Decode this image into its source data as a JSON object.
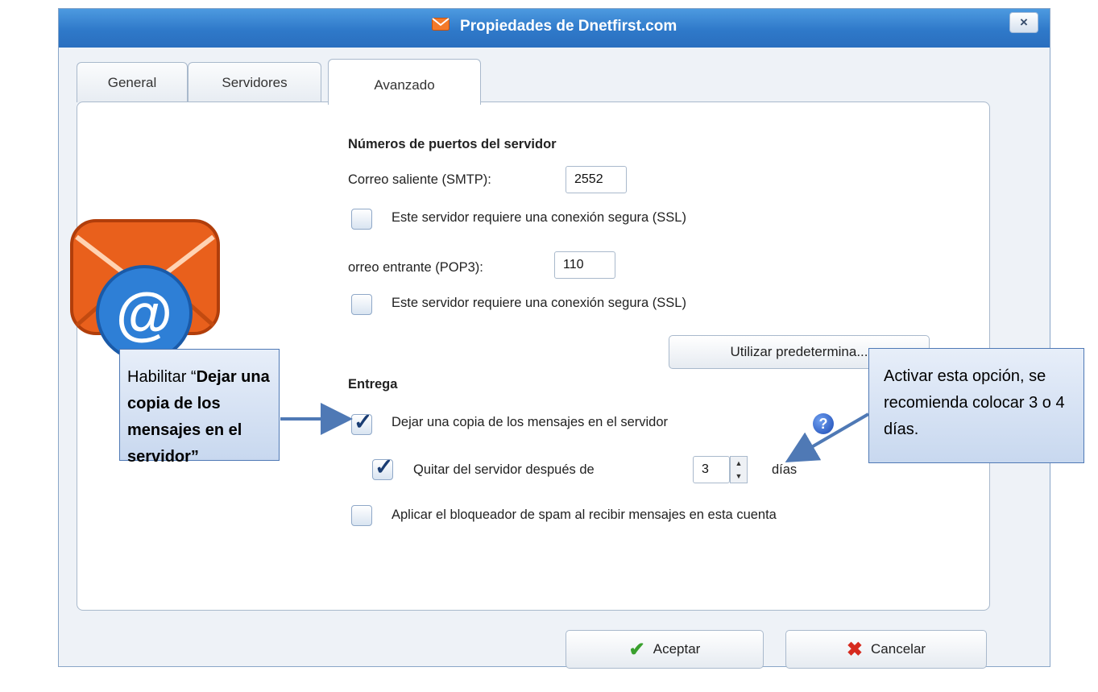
{
  "window": {
    "title": "Propiedades de Dnetfirst.com",
    "close_label": "×"
  },
  "tabs": [
    {
      "label": "General"
    },
    {
      "label": "Servidores"
    },
    {
      "label": "Avanzado"
    }
  ],
  "ports": {
    "heading": "Números de puertos del servidor",
    "smtp_label": "Correo saliente (SMTP):",
    "smtp_value": "2552",
    "smtp_ssl_label": "Este servidor requiere una conexión segura (SSL)",
    "smtp_ssl_checked": false,
    "pop3_label": "orreo entrante (POP3):",
    "pop3_value": "110",
    "pop3_ssl_label": "Este servidor requiere una conexión segura (SSL)",
    "pop3_ssl_checked": false,
    "defaults_button": "Utilizar predetermina..."
  },
  "delivery": {
    "heading": "Entrega",
    "leave_copy_label": "Dejar una copia de los mensajes en el servidor",
    "leave_copy_checked": true,
    "remove_after_label": "Quitar del servidor después de",
    "remove_after_checked": true,
    "days_value": "3",
    "days_label": "días",
    "spam_label": "Aplicar el bloqueador de spam al recibir mensajes en esta cuenta",
    "spam_checked": false,
    "help_glyph": "?"
  },
  "buttons": {
    "accept": "Aceptar",
    "cancel": "Cancelar"
  },
  "callouts": {
    "left_prefix": "Habilitar “",
    "left_bold": "Dejar una copia de los mensajes en el servidor”",
    "right": "Activar esta opción, se recomienda colocar 3 o 4 días."
  },
  "colors": {
    "titlebar": "#2f79c9",
    "accent": "#4f79b5",
    "checkmark": "#1a3d73"
  }
}
